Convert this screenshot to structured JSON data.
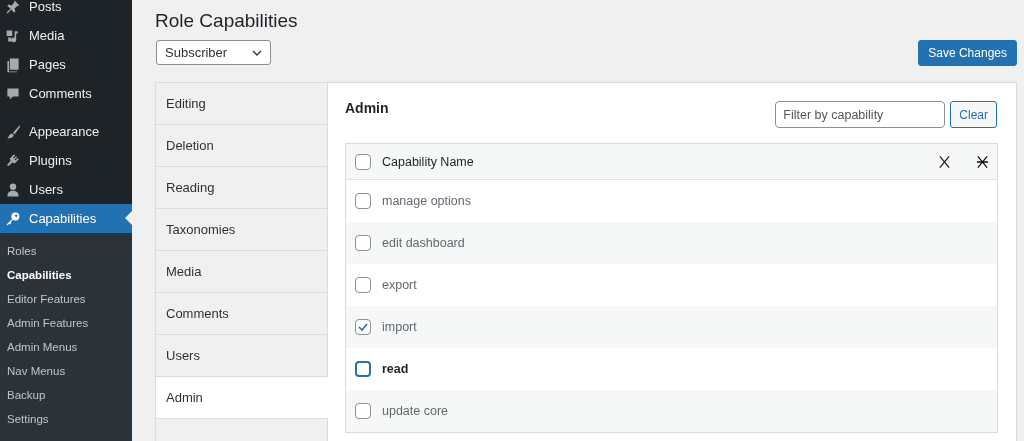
{
  "sidebar": {
    "items": [
      {
        "label": "Posts",
        "selected": false
      },
      {
        "label": "Media",
        "selected": false
      },
      {
        "label": "Pages",
        "selected": false
      },
      {
        "label": "Comments",
        "selected": false
      },
      {
        "label": "Appearance",
        "selected": false
      },
      {
        "label": "Plugins",
        "selected": false
      },
      {
        "label": "Users",
        "selected": false
      },
      {
        "label": "Capabilities",
        "selected": true
      }
    ],
    "submenu": [
      {
        "label": "Roles",
        "selected": false
      },
      {
        "label": "Capabilities",
        "selected": true
      },
      {
        "label": "Editor Features",
        "selected": false
      },
      {
        "label": "Admin Features",
        "selected": false
      },
      {
        "label": "Admin Menus",
        "selected": false
      },
      {
        "label": "Nav Menus",
        "selected": false
      },
      {
        "label": "Backup",
        "selected": false
      },
      {
        "label": "Settings",
        "selected": false
      }
    ]
  },
  "page": {
    "title": "Role Capabilities",
    "role_select": {
      "value": "Subscriber"
    },
    "save_button": "Save Changes"
  },
  "tabs": [
    {
      "label": "Editing",
      "selected": false
    },
    {
      "label": "Deletion",
      "selected": false
    },
    {
      "label": "Reading",
      "selected": false
    },
    {
      "label": "Taxonomies",
      "selected": false
    },
    {
      "label": "Media",
      "selected": false
    },
    {
      "label": "Comments",
      "selected": false
    },
    {
      "label": "Users",
      "selected": false
    },
    {
      "label": "Admin",
      "selected": true
    }
  ],
  "section": {
    "title": "Admin",
    "filter": {
      "placeholder": "Filter by capability"
    },
    "clear_button": "Clear"
  },
  "table": {
    "header": {
      "label": "Capability Name",
      "checked": false
    },
    "rows": [
      {
        "name": "manage options",
        "checked": false,
        "focused": false
      },
      {
        "name": "edit dashboard",
        "checked": false,
        "focused": false
      },
      {
        "name": "export",
        "checked": false,
        "focused": false
      },
      {
        "name": "import",
        "checked": true,
        "focused": false
      },
      {
        "name": "read",
        "checked": false,
        "focused": true
      },
      {
        "name": "update core",
        "checked": false,
        "focused": false
      }
    ]
  }
}
